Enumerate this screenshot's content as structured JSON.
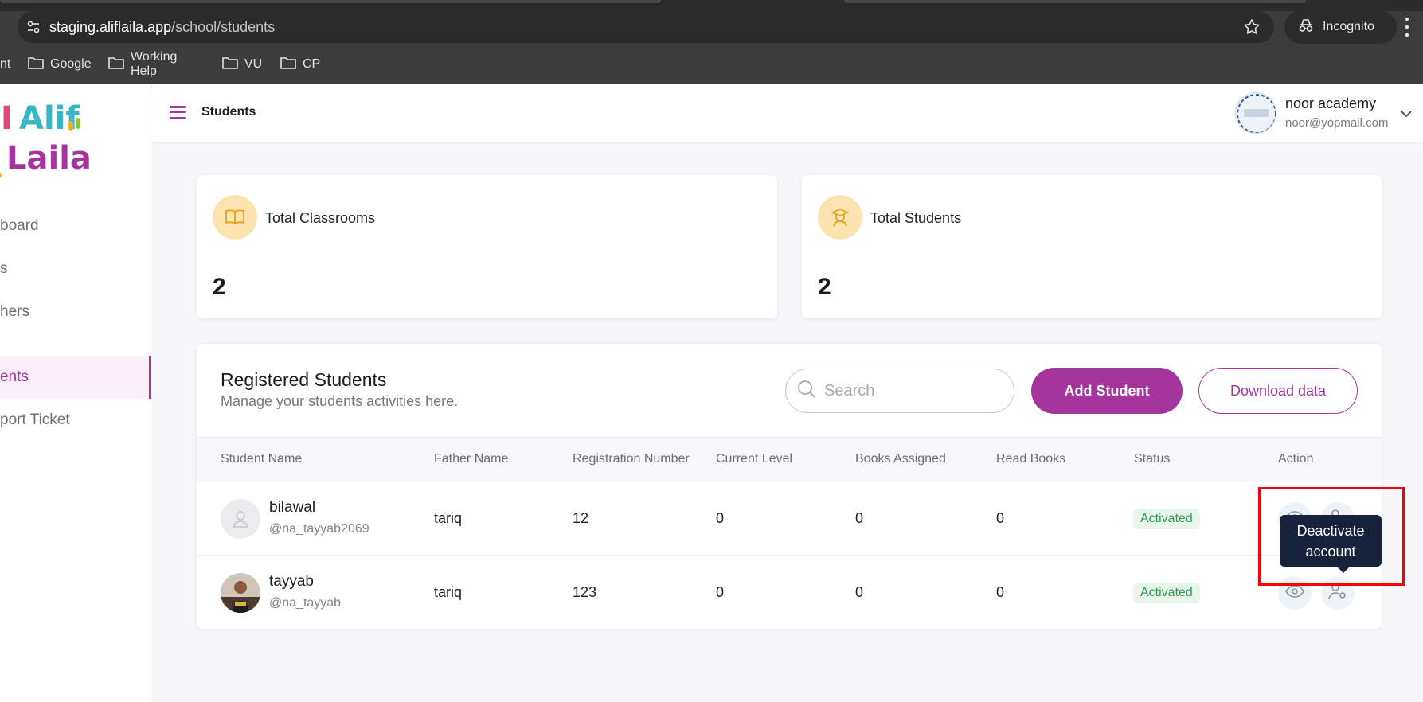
{
  "browser": {
    "url_host": "staging.aliflaila.app",
    "url_path": "/school/students",
    "incognito_label": "Incognito",
    "bookmarks": [
      "nt",
      "Google",
      "Working Help",
      "VU",
      "CP"
    ]
  },
  "sidebar": {
    "logo_alt": "Alif Laila",
    "items": [
      {
        "label": "board",
        "active": false
      },
      {
        "label": "s",
        "active": false
      },
      {
        "label": "hers",
        "active": false
      },
      {
        "label": "ents",
        "active": true
      },
      {
        "label": "port Ticket",
        "active": false
      }
    ]
  },
  "header": {
    "title": "Students",
    "user_name": "noor academy",
    "user_email": "noor@yopmail.com"
  },
  "stats": [
    {
      "title": "Total Classrooms",
      "value": "2",
      "icon": "book-icon"
    },
    {
      "title": "Total Students",
      "value": "2",
      "icon": "graduate-icon"
    }
  ],
  "students_panel": {
    "title": "Registered Students",
    "subtitle": "Manage your students activities here.",
    "search_placeholder": "Search",
    "add_label": "Add Student",
    "download_label": "Download data",
    "columns": [
      "Student Name",
      "Father Name",
      "Registration Number",
      "Current Level",
      "Books Assigned",
      "Read Books",
      "Status",
      "Action"
    ],
    "rows": [
      {
        "name": "bilawal",
        "handle": "@na_tayyab2069",
        "father": "tariq",
        "reg": "12",
        "level": "0",
        "books": "0",
        "read": "0",
        "status": "Activated",
        "avatar": "placeholder"
      },
      {
        "name": "tayyab",
        "handle": "@na_tayyab",
        "father": "tariq",
        "reg": "123",
        "level": "0",
        "books": "0",
        "read": "0",
        "status": "Activated",
        "avatar": "photo"
      }
    ]
  },
  "tooltip": {
    "text_line1": "Deactivate",
    "text_line2": "account"
  },
  "colors": {
    "brand": "#a3359d",
    "status_green": "#2b9c4e",
    "highlight": "#ff0000"
  }
}
